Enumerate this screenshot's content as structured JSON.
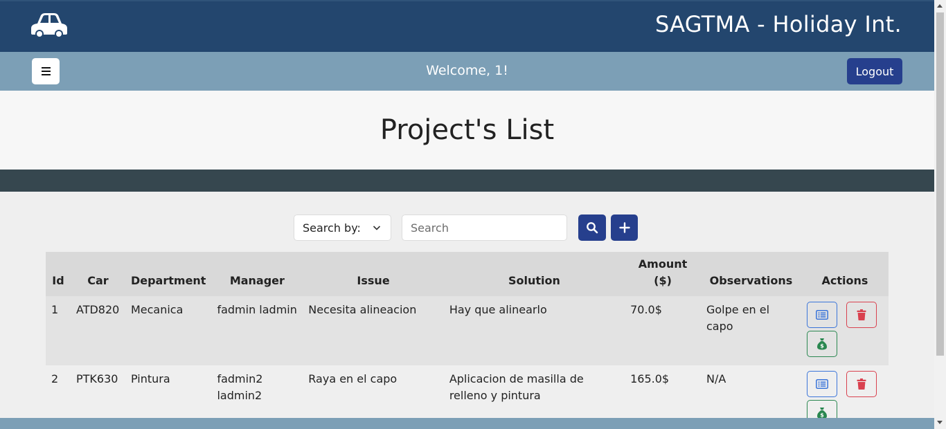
{
  "header": {
    "app_title": "SAGTMA - Holiday Int.",
    "logo_icon": "car-icon"
  },
  "navbar": {
    "menu_icon": "hamburger-icon",
    "welcome": "Welcome, 1!",
    "logout_label": "Logout"
  },
  "page": {
    "title": "Project's List"
  },
  "search": {
    "select_label": "Search by:",
    "placeholder": "Search",
    "search_icon": "search-icon",
    "add_icon": "plus-icon"
  },
  "table": {
    "headers": {
      "id": "Id",
      "car": "Car",
      "department": "Department",
      "manager": "Manager",
      "issue": "Issue",
      "solution": "Solution",
      "amount_line1": "Amount",
      "amount_line2": "($)",
      "observations": "Observations",
      "actions": "Actions"
    },
    "rows": [
      {
        "id": "1",
        "car": "ATD820",
        "department": "Mecanica",
        "manager": "fadmin ladmin",
        "issue": "Necesita alineacion",
        "solution": "Hay que alinearlo",
        "amount": "70.0$",
        "observations": "Golpe en el capo"
      },
      {
        "id": "2",
        "car": "PTK630",
        "department": "Pintura",
        "manager": "fadmin2 ladmin2",
        "issue": "Raya en el capo",
        "solution": "Aplicacion de masilla de relleno y pintura",
        "amount": "165.0$",
        "observations": "N/A"
      }
    ]
  },
  "colors": {
    "header_bg": "#23466e",
    "navbar_bg": "#7c9fb6",
    "primary_button": "#263f8d",
    "dark_band": "#36474f",
    "details_blue": "#3a74d9",
    "delete_red": "#d9414f",
    "money_green": "#2a8750"
  }
}
